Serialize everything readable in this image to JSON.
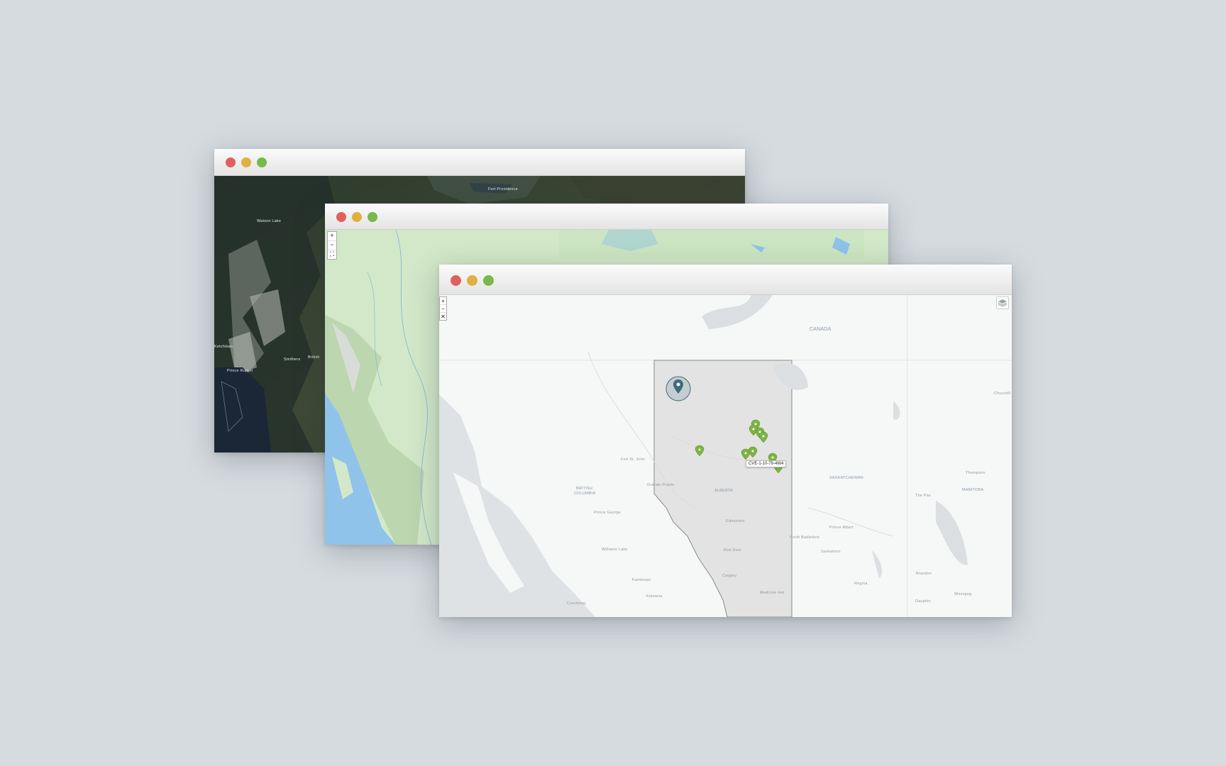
{
  "windows": {
    "satellite": {
      "labels": {
        "watson_lake": "Watson Lake",
        "fort_providence": "Fort Providence",
        "ketchikan": "Ketchikan",
        "prince_rupert": "Prince Rupert",
        "smithers": "Smithers",
        "british": "British"
      }
    },
    "topo": {
      "controls": {
        "zoom_in": "+",
        "zoom_out": "−",
        "fullscreen": "⛶"
      }
    },
    "main": {
      "controls": {
        "zoom_in": "+",
        "zoom_out": "−",
        "fullscreen": "✕"
      },
      "layers_icon": "layers-icon",
      "tooltip": "CVE-1-10-79-4W4",
      "labels": {
        "canada": "CANADA",
        "british_columbia_1": "BRITISH",
        "british_columbia_2": "COLUMBIA",
        "alberta": "ALBERTA",
        "saskatchewan": "SASKATCHEWAN",
        "manitoba": "MANITOBA",
        "fort_st_john": "Fort St. John",
        "grande_prairie": "Grande Prairie",
        "prince_george": "Prince George",
        "williams_lake": "Williams Lake",
        "kamloops": "Kamloops",
        "kelowna": "Kelowna",
        "edmonton": "Edmonton",
        "red_deer": "Red Deer",
        "calgary": "Calgary",
        "medicine_hat": "Medicine Hat",
        "north_battleford": "North Battleford",
        "prince_albert": "Prince Albert",
        "saskatoon": "Saskatoon",
        "regina": "Regina",
        "brandon": "Brandon",
        "winnipeg": "Winnipeg",
        "dauphin": "Dauphin",
        "the_pas": "The Pas",
        "thompson": "Thompson",
        "churchill": "Churchill",
        "courtenay": "Courtenay"
      },
      "colors": {
        "marker": "#7cb342",
        "selected_marker": "#3d6b7a",
        "region_fill": "#e3e3e3"
      }
    }
  }
}
